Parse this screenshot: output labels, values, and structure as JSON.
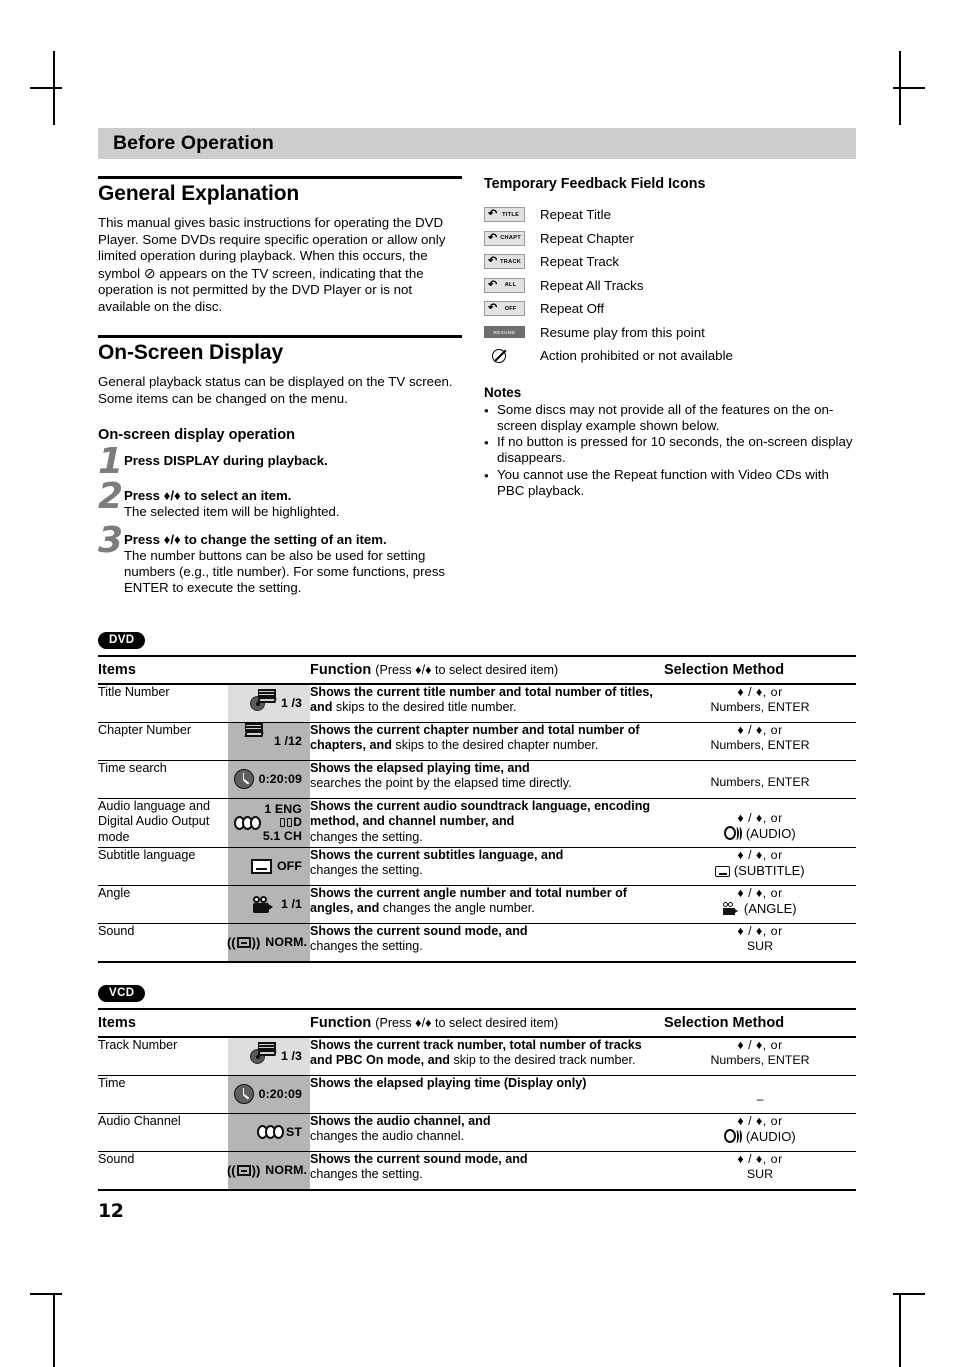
{
  "running_head": {
    "title": "Before Operation"
  },
  "left_column": {
    "general_explanation": {
      "heading": "General Explanation",
      "paragraph_part1": "This manual gives basic instructions for operating the DVD Player. Some DVDs require specific operation or allow only limited operation during playback. When this occurs, the symbol",
      "paragraph_part2": "appears on the TV screen, indicating that the operation is not permitted by the DVD Player or is not available on the disc."
    },
    "on_screen_display": {
      "heading": "On-Screen Display",
      "paragraph": "General playback status can be displayed on the TV screen. Some items can be changed on the menu.",
      "operation_heading": "On-screen display operation",
      "steps": [
        {
          "num": "1",
          "bold": "Press DISPLAY during playback.",
          "rest": ""
        },
        {
          "num": "2",
          "bold": "Press ♦/♦ to select an item.",
          "rest": "The selected item will be highlighted."
        },
        {
          "num": "3",
          "bold": "Press ♦/♦ to change the setting of an item.",
          "rest": "The number buttons can be also be used for setting numbers (e.g., title number). For some functions, press ENTER to execute the setting."
        }
      ]
    }
  },
  "right_column": {
    "feedback_heading": "Temporary Feedback Field Icons",
    "feedback_rows": [
      {
        "icon": "repeat-title-icon",
        "badge": "TITLE",
        "label": "Repeat Title"
      },
      {
        "icon": "repeat-chapter-icon",
        "badge": "CHAPT",
        "label": "Repeat Chapter"
      },
      {
        "icon": "repeat-track-icon",
        "badge": "TRACK",
        "label": "Repeat Track"
      },
      {
        "icon": "repeat-all-icon",
        "badge": "ALL",
        "label": "Repeat All Tracks"
      },
      {
        "icon": "repeat-off-icon",
        "badge": "OFF",
        "label": "Repeat Off"
      },
      {
        "icon": "resume-icon",
        "badge": "RESUME",
        "label": "Resume play from this point"
      },
      {
        "icon": "prohibited-icon",
        "badge": "",
        "label": "Action prohibited or not available"
      }
    ],
    "notes_heading": "Notes",
    "notes": [
      "Some discs may not provide all of the features on the on-screen display example shown below.",
      "If no button is pressed for 10 seconds, the on-screen display disappears.",
      "You cannot use the Repeat function with Video CDs with PBC playback."
    ]
  },
  "tables": [
    {
      "badge": "DVD",
      "headers": {
        "items": "Items",
        "function_bold": "Function",
        "function_small": "(Press ♦/♦ to select desired item)",
        "selection": "Selection Method"
      },
      "rows": [
        {
          "item": "Title Number",
          "icon": "title-number-osd-icon",
          "icon_shade": "light",
          "value": "1 /3",
          "fn_bold": "Shows the current title number and total number of titles, and",
          "fn_rest": " skips to the desired title number.",
          "sel_arrows": "♦ / ♦, or",
          "sel_text": "Numbers, ENTER",
          "sel_icon": ""
        },
        {
          "item": "Chapter Number",
          "icon": "chapter-number-osd-icon",
          "icon_shade": "dark",
          "value": "1 /12",
          "fn_bold": "Shows the current chapter number and total number of chapters, and",
          "fn_rest": " skips to the desired chapter number.",
          "sel_arrows": "♦ / ♦, or",
          "sel_text": "Numbers, ENTER",
          "sel_icon": ""
        },
        {
          "item": "Time search",
          "icon": "time-search-osd-icon",
          "icon_shade": "dark",
          "value": "0:20:09",
          "fn_bold": "Shows the elapsed playing time, and",
          "fn_rest": "searches the point by the elapsed time directly.",
          "sel_arrows": "",
          "sel_text": "Numbers, ENTER",
          "sel_icon": ""
        },
        {
          "item": "Audio language and Digital Audio Output mode",
          "icon": "audio-language-osd-icon",
          "icon_shade": "dark",
          "value": "1 ENG",
          "value2": "D",
          "value3": "5.1 CH",
          "fn_bold": "Shows the current audio soundtrack language, encoding method, and channel number, and",
          "fn_rest": "changes the setting.",
          "sel_arrows": "♦ / ♦, or",
          "sel_text": "(AUDIO)",
          "sel_icon": "audio-button-icon"
        },
        {
          "item": "Subtitle language",
          "icon": "subtitle-osd-icon",
          "icon_shade": "dark",
          "value": "OFF",
          "fn_bold": "Shows the current subtitles language, and",
          "fn_rest": "changes the setting.",
          "sel_arrows": "♦ / ♦, or",
          "sel_text": "(SUBTITLE)",
          "sel_icon": "subtitle-button-icon"
        },
        {
          "item": "Angle",
          "icon": "angle-osd-icon",
          "icon_shade": "dark",
          "value": "1 /1",
          "fn_bold": "Shows the current angle number and total number of angles, and",
          "fn_rest": " changes the angle number.",
          "sel_arrows": "♦ / ♦, or",
          "sel_text": "(ANGLE)",
          "sel_icon": "angle-button-icon"
        },
        {
          "item": "Sound",
          "icon": "sound-osd-icon",
          "icon_shade": "dark",
          "value": "NORM.",
          "fn_bold": "Shows the current sound mode, and",
          "fn_rest": "changes the setting.",
          "sel_arrows": "♦ / ♦, or",
          "sel_text": "SUR",
          "sel_icon": ""
        }
      ]
    },
    {
      "badge": "VCD",
      "headers": {
        "items": "Items",
        "function_bold": "Function",
        "function_small": "(Press ♦/♦ to select desired item)",
        "selection": "Selection Method"
      },
      "rows": [
        {
          "item": "Track Number",
          "icon": "track-number-osd-icon",
          "icon_shade": "light",
          "value": "1 /3",
          "fn_bold": "Shows the current track number, total number of tracks and PBC On mode, and",
          "fn_rest": " skip to the desired track number.",
          "sel_arrows": "♦ / ♦, or",
          "sel_text": "Numbers, ENTER",
          "sel_icon": ""
        },
        {
          "item": "Time",
          "icon": "time-osd-icon",
          "icon_shade": "dark",
          "value": "0:20:09",
          "fn_bold": "Shows the elapsed playing time (Display only)",
          "fn_rest": "",
          "sel_arrows": "",
          "sel_text": "–",
          "sel_icon": ""
        },
        {
          "item": "Audio Channel",
          "icon": "audio-channel-osd-icon",
          "icon_shade": "dark",
          "value": "ST",
          "fn_bold": "Shows the audio channel, and",
          "fn_rest": "changes the audio channel.",
          "sel_arrows": "♦ / ♦, or",
          "sel_text": "(AUDIO)",
          "sel_icon": "audio-button-icon"
        },
        {
          "item": "Sound",
          "icon": "sound-osd-icon",
          "icon_shade": "dark",
          "value": "NORM.",
          "fn_bold": "Shows the current sound mode, and",
          "fn_rest": "changes the setting.",
          "sel_arrows": "♦ / ♦, or",
          "sel_text": "SUR",
          "sel_icon": ""
        }
      ]
    }
  ],
  "footer": {
    "page_number": "12"
  }
}
